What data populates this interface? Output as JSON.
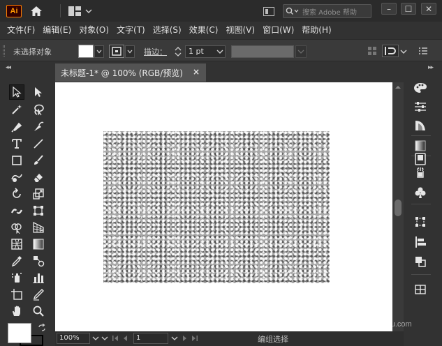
{
  "app": {
    "logo_text": "Ai",
    "search_placeholder": "搜索 Adobe 帮助",
    "window_buttons": [
      "–",
      "☐",
      "✕"
    ]
  },
  "menu": [
    "文件(F)",
    "编辑(E)",
    "对象(O)",
    "文字(T)",
    "选择(S)",
    "效果(C)",
    "视图(V)",
    "窗口(W)",
    "帮助(H)"
  ],
  "control_bar": {
    "selection_label": "未选择对象",
    "stroke_label": "描边：",
    "stroke_value": "1 pt",
    "fill_color": "#ffffff"
  },
  "document": {
    "tab_title": "未标题-1* @ 100% (RGB/预览)",
    "close_label": "×"
  },
  "status_bar": {
    "zoom": "100%",
    "page": "1",
    "status": "编组选择"
  },
  "watermark": {
    "text": "jingyan.baidu.com"
  },
  "colors": {
    "ui_dark": "#323232",
    "canvas_bg": "#535353",
    "artboard": "#ffffff",
    "texture_base": "#a9a9a9",
    "logo_orange": "#ff9a00"
  },
  "icons": {
    "toolbar": [
      "selection-tool-icon",
      "direct-selection-tool-icon",
      "magic-wand-icon",
      "lasso-icon",
      "pen-icon",
      "curvature-icon",
      "type-icon",
      "line-icon",
      "rectangle-icon",
      "paintbrush-icon",
      "shaper-icon",
      "eraser-icon",
      "rotate-icon",
      "scale-icon",
      "width-icon",
      "free-transform-icon",
      "shape-builder-icon",
      "perspective-grid-icon",
      "mesh-icon",
      "gradient-icon",
      "eyedropper-icon",
      "blend-icon",
      "symbol-sprayer-icon",
      "column-graph-icon",
      "artboard-icon",
      "slice-icon",
      "hand-icon",
      "zoom-icon"
    ],
    "right_panel": [
      "color-icon",
      "properties-icon",
      "color-guide-icon",
      "gradient-panel-icon",
      "libraries-icon",
      "symbols-icon",
      "clubs-icon",
      "transform-icon",
      "align-icon",
      "pathfinder-icon",
      "layers-icon"
    ]
  }
}
